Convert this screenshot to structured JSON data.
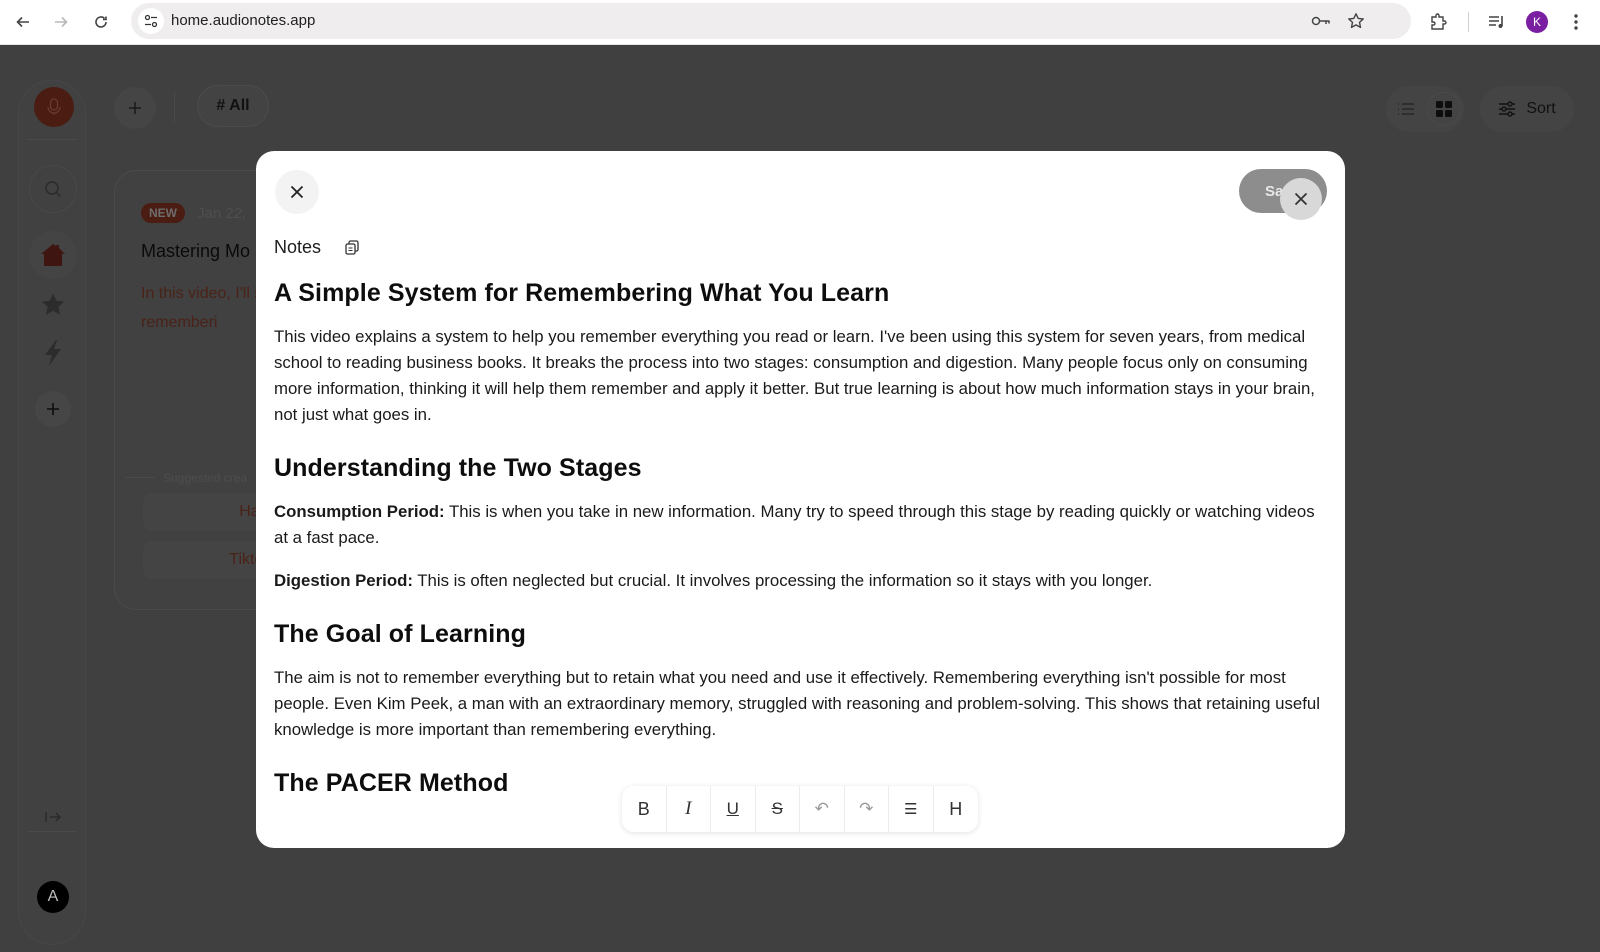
{
  "browser": {
    "url": "home.audionotes.app",
    "profile_initial": "K",
    "profile_color": "#7a1fa2",
    "icons": [
      "back-icon",
      "forward-icon",
      "reload-icon",
      "site-info-icon",
      "password-key-icon",
      "bookmark-star-icon",
      "extensions-icon",
      "media-queue-icon",
      "kebab-menu-icon"
    ]
  },
  "app": {
    "brand_color": "#4a1c12",
    "sidebar": {
      "items": [
        "record",
        "search",
        "home",
        "favorites",
        "flash",
        "add"
      ],
      "user_initial": "A"
    },
    "topbar": {
      "filter_chip": "# All",
      "sort_label": "Sort"
    },
    "card": {
      "badge": "NEW",
      "date": "Jan 22,",
      "title": "Mastering Mo",
      "description": "In this video, I'll share a system for rememberi",
      "suggested_label": "Suggested crea",
      "suggestions": [
        "Hashtags",
        "Tiktok Script"
      ]
    }
  },
  "modal": {
    "save_label": "Save",
    "section_label": "Notes",
    "title": "A Simple System for Remembering What You Learn",
    "intro": "This video explains a system to help you remember everything you read or learn. I've been using this system for seven years, from medical school to reading business books. It breaks the process into two stages: consumption and digestion. Many people focus only on consuming more information, thinking it will help them remember and apply it better. But true learning is about how much information stays in your brain, not just what goes in.",
    "section2": {
      "heading": "Understanding the Two Stages",
      "item1_label": "Consumption Period:",
      "item1_text": " This is when you take in new information. Many try to speed through this stage by reading quickly or watching videos at a fast pace.",
      "item2_label": "Digestion Period:",
      "item2_text": " This is often neglected but crucial. It involves processing the information so it stays with you longer."
    },
    "section3": {
      "heading": "The Goal of Learning",
      "text": "The aim is not to remember everything but to retain what you need and use it effectively. Remembering everything isn't possible for most people. Even Kim Peek, a man with an extraordinary memory, struggled with reasoning and problem-solving. This shows that retaining useful knowledge is more important than remembering everything."
    },
    "section4": {
      "heading": "The PACER Method"
    },
    "toolbar": {
      "bold": "B",
      "italic": "I",
      "underline": "U",
      "strike": "S",
      "undo": "↶",
      "redo": "↷",
      "list": "☰",
      "heading": "H"
    }
  }
}
